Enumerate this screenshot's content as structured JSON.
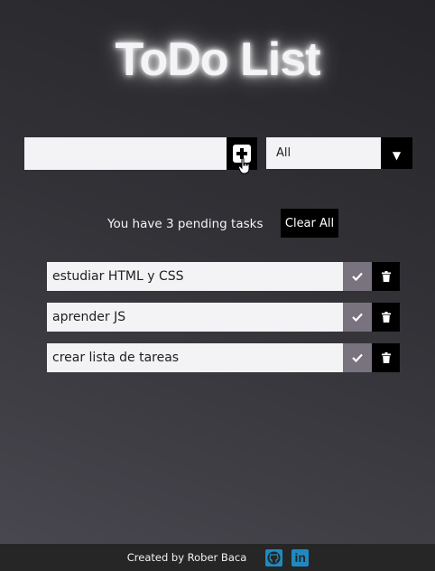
{
  "header": {
    "title": "ToDo List"
  },
  "form": {
    "input_value": "",
    "input_placeholder": "",
    "add_icon": "plus-square-icon",
    "filter": {
      "selected": "All",
      "arrow": "▼"
    }
  },
  "status": {
    "pending_text": "You have 3 pending tasks",
    "clear_label": "Clear All"
  },
  "todos": [
    {
      "text": "estudiar HTML y CSS"
    },
    {
      "text": "aprender JS"
    },
    {
      "text": "crear lista de tareas"
    }
  ],
  "footer": {
    "credit": "Created by Rober Baca",
    "icons": [
      "github-icon",
      "linkedin-icon"
    ],
    "linkedin_glyph": "in"
  },
  "colors": {
    "check_bg": "#78737f",
    "trash_bg": "#000000",
    "social_accent": "#1f8ac0",
    "footer_bg": "#262626"
  }
}
